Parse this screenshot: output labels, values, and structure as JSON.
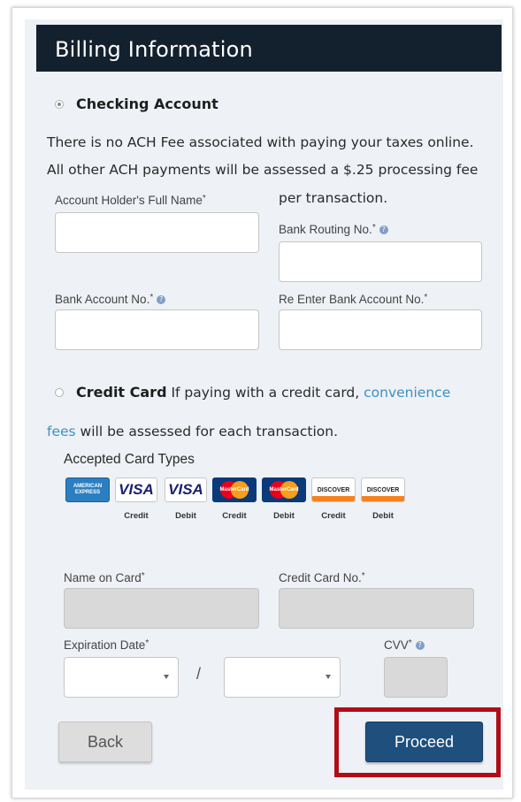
{
  "header": {
    "title": "Billing Information"
  },
  "checking": {
    "option_label": "Checking Account",
    "selected": true,
    "fee_line1": "There is no ACH Fee associated with paying your taxes online.",
    "fee_line2": "All other ACH payments will be assessed a $.25 processing fee",
    "fee_line3": "per transaction.",
    "fields": {
      "holder_name_label": "Account Holder's Full Name",
      "routing_label": "Bank Routing No.",
      "account_label": "Bank Account No.",
      "reenter_label": "Re Enter Bank Account No.",
      "required_mark": "*",
      "info_glyph": "?"
    }
  },
  "credit": {
    "option_label": "Credit Card",
    "selected": false,
    "text_before_link": "If paying with a credit card,",
    "link_part1": "convenience",
    "link_part2": "fees",
    "text_after_link": "will be assessed for each transaction.",
    "accepted_label": "Accepted Card Types",
    "cards": [
      {
        "brand": "AMERICAN EXPRESS",
        "caption": ""
      },
      {
        "brand": "VISA",
        "caption": "Credit"
      },
      {
        "brand": "VISA",
        "caption": "Debit"
      },
      {
        "brand": "MasterCard",
        "caption": "Credit"
      },
      {
        "brand": "MasterCard",
        "caption": "Debit"
      },
      {
        "brand": "DISCOVER",
        "caption": "Credit"
      },
      {
        "brand": "DISCOVER",
        "caption": "Debit"
      }
    ],
    "fields": {
      "name_label": "Name on Card",
      "number_label": "Credit Card No.",
      "expiration_label": "Expiration Date",
      "separator": "/",
      "cvv_label": "CVV"
    }
  },
  "buttons": {
    "back": "Back",
    "proceed": "Proceed"
  },
  "colors": {
    "header_bg": "#13212f",
    "panel_bg": "#eef1f5",
    "link": "#3d8fc4",
    "proceed_bg": "#1e4f7d",
    "highlight_border": "#b00d17"
  }
}
